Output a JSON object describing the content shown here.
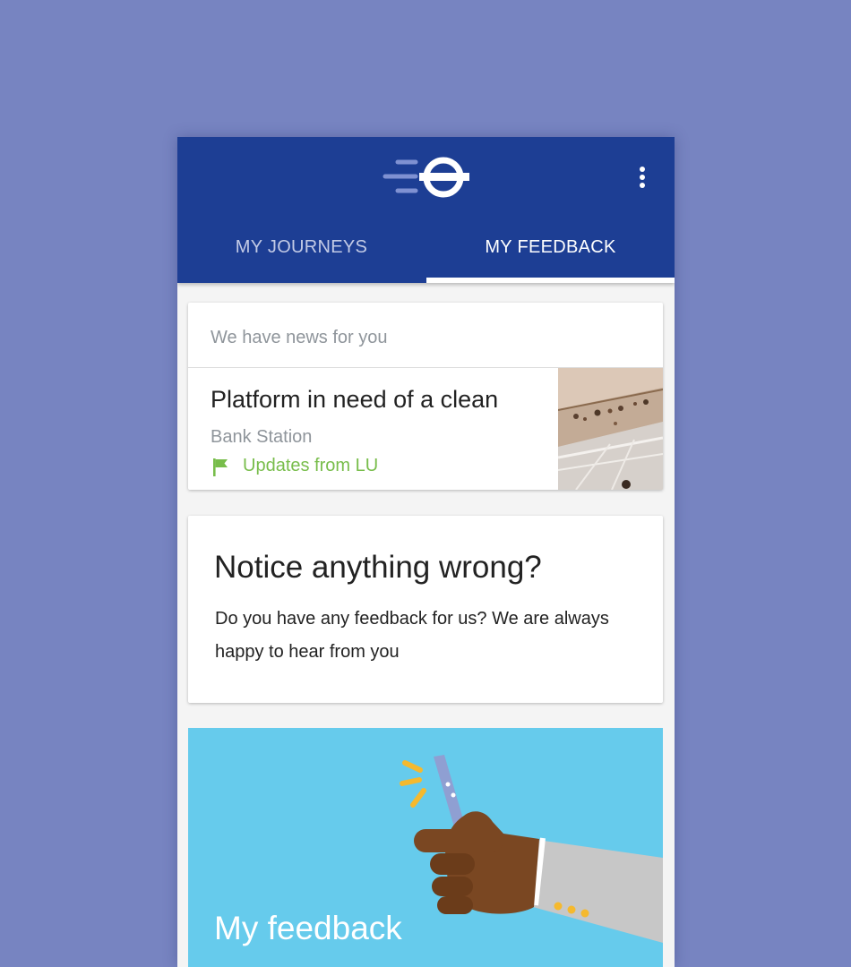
{
  "tabs": [
    {
      "label": "MY JOURNEYS",
      "selected": false
    },
    {
      "label": "MY FEEDBACK",
      "selected": true
    }
  ],
  "icons": {
    "logo": "tfl-roundel-logo",
    "menu": "more-vertical-icon",
    "flag": "flag-icon",
    "thumbnail": "station-ceiling-photo",
    "illustration": "hand-holding-phone-illustration"
  },
  "news": {
    "header": "We have news for you",
    "item": {
      "title": "Platform in need of a clean",
      "location": "Bank Station",
      "update": "Updates from LU"
    }
  },
  "notice": {
    "title": "Notice anything wrong?",
    "body": "Do you have any feedback for us? We are always happy to hear from you"
  },
  "feedback": {
    "title": "My feedback"
  },
  "colors": {
    "background": "#7784c1",
    "app_bar": "#1d3e94",
    "accent_green": "#78bd4b",
    "feedback_card": "#66cbec"
  }
}
